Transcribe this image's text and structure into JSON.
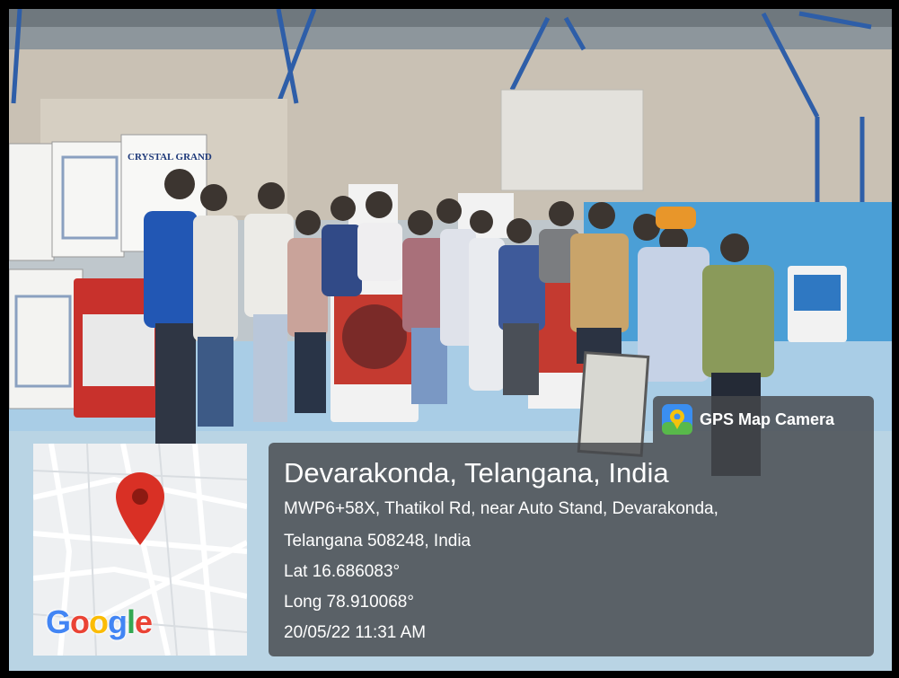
{
  "badge": {
    "icon": "gps-map-camera-app-icon",
    "label": "GPS Map Camera"
  },
  "location": {
    "place": "Devarakonda, Telangana, India",
    "address_line_1": "MWP6+58X, Thatikol Rd, near Auto Stand, Devarakonda,",
    "address_line_2": "Telangana 508248, India",
    "latitude": "Lat 16.686083°",
    "longitude": "Long 78.910068°",
    "datetime": "20/05/22 11:31 AM"
  },
  "map": {
    "marker_icon": "map-pin-icon",
    "marker_color": "#d93025",
    "logo_text": {
      "G": "G",
      "o1": "o",
      "o2": "o",
      "g": "g",
      "l": "l",
      "e": "e"
    },
    "logo_colors": [
      "#4285f4",
      "#ea4335",
      "#fbbc05",
      "#4285f4",
      "#34a853",
      "#ea4335"
    ]
  },
  "photo": {
    "carton_text": "CRYSTAL GRAND"
  }
}
